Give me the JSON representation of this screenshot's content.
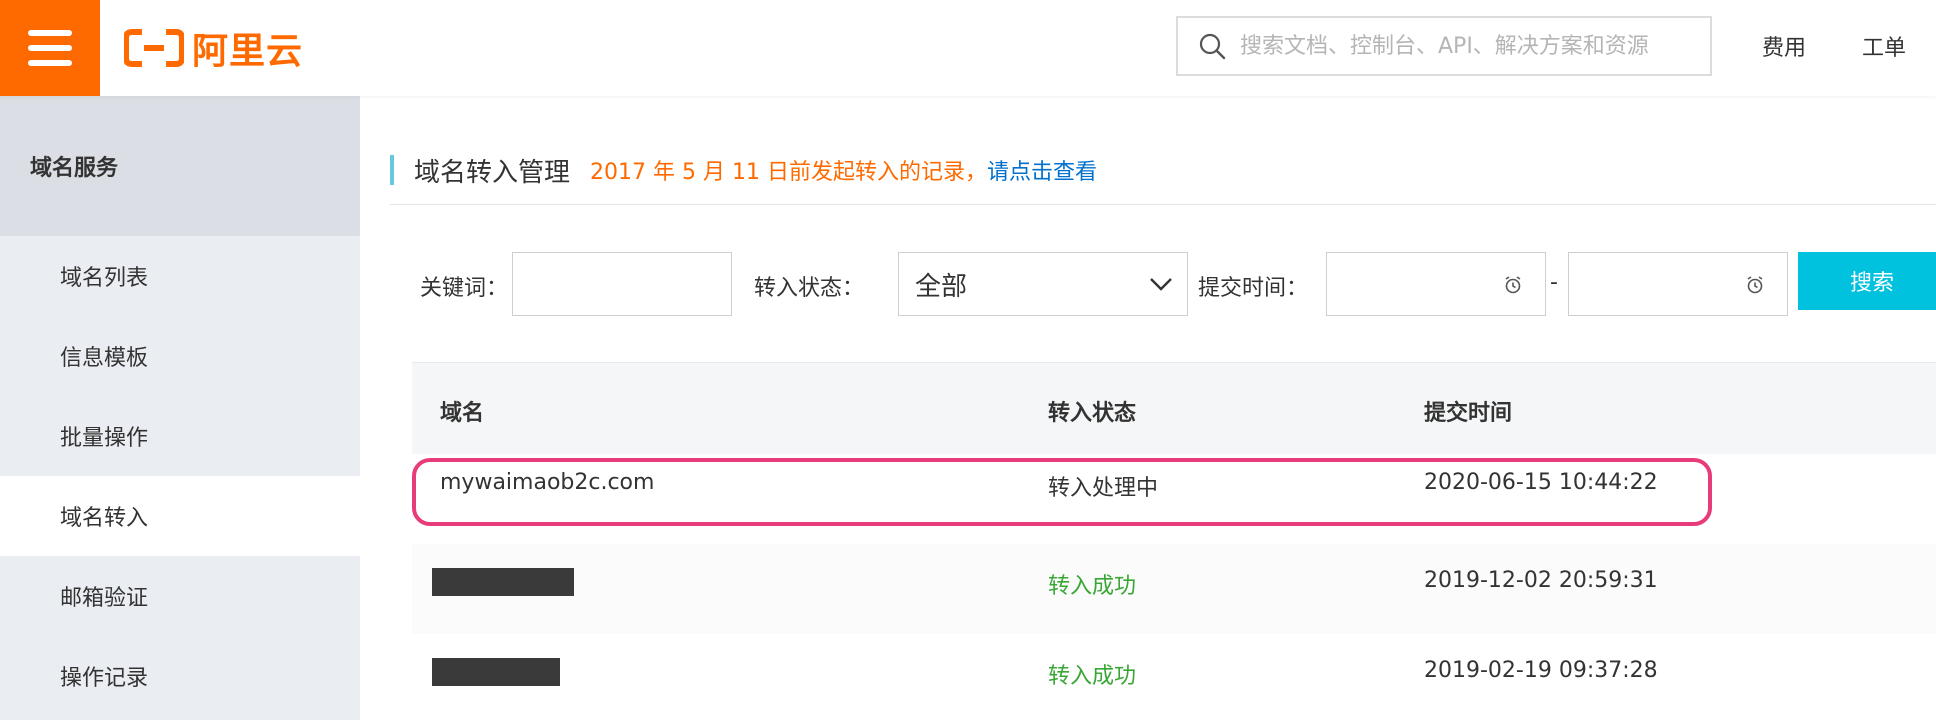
{
  "header": {
    "logo_text": "阿里云",
    "search_placeholder": "搜索文档、控制台、API、解决方案和资源",
    "links": [
      "费用",
      "工单"
    ],
    "brand_color": "#ff6a00"
  },
  "sidebar": {
    "section_title": "域名服务",
    "items": [
      {
        "label": "域名列表",
        "active": false
      },
      {
        "label": "信息模板",
        "active": false
      },
      {
        "label": "批量操作",
        "active": false
      },
      {
        "label": "域名转入",
        "active": true
      },
      {
        "label": "邮箱验证",
        "active": false
      },
      {
        "label": "操作记录",
        "active": false
      }
    ]
  },
  "main": {
    "page_title": "域名转入管理",
    "notice": "2017 年 5 月 11 日前发起转入的记录，",
    "notice_link": "请点击查看",
    "filters": {
      "keyword_label": "关键词：",
      "keyword_value": "",
      "status_label": "转入状态：",
      "status_value": "全部",
      "time_label": "提交时间：",
      "time_separator": "-",
      "search_button": "搜索"
    },
    "table": {
      "columns": [
        "域名",
        "转入状态",
        "提交时间"
      ],
      "rows": [
        {
          "domain": "mywaimaob2c.com",
          "status": "转入处理中",
          "submitted": "2020-06-15 10:44:22",
          "highlighted": true
        },
        {
          "domain": "",
          "status": "转入成功",
          "submitted": "2019-12-02 20:59:31",
          "highlighted": false
        },
        {
          "domain": "",
          "status": "转入成功",
          "submitted": "2019-02-19 09:37:28",
          "highlighted": false
        }
      ]
    }
  }
}
